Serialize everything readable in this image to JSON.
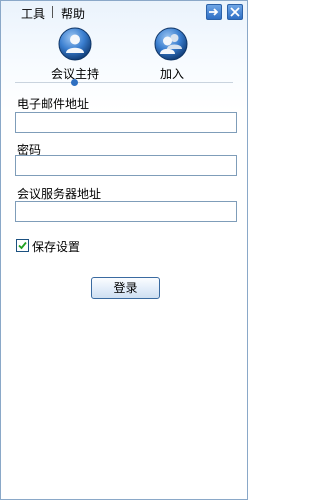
{
  "menu": {
    "tools": "工具",
    "help": "帮助"
  },
  "window_buttons": {
    "pin_icon": "arrow-right-icon",
    "close_icon": "close-icon"
  },
  "modes": [
    {
      "label": "会议主持",
      "icon": "person-icon",
      "selected": true
    },
    {
      "label": "加入",
      "icon": "group-icon",
      "selected": false
    }
  ],
  "form": {
    "email_label": "电子邮件地址",
    "email_value": "",
    "password_label": "密码",
    "password_value": "",
    "server_label": "会议服务器地址",
    "server_value": "",
    "save_settings_label": "保存设置",
    "save_settings_checked": true
  },
  "login_label": "登录",
  "colors": {
    "accent": "#2e6fc1",
    "border": "#7f9db9"
  }
}
